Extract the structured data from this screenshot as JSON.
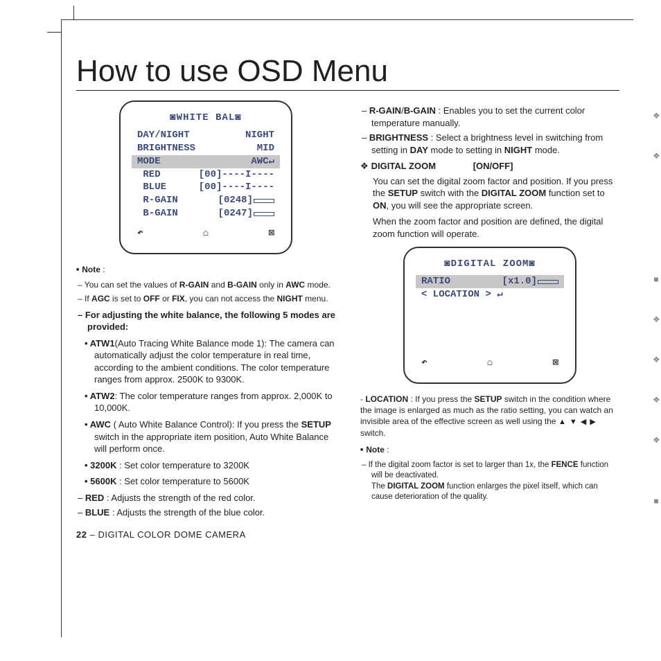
{
  "title": "How to use OSD Menu",
  "osd1": {
    "title": "◙WHITE BAL◙",
    "rows": [
      {
        "label": "DAY/NIGHT",
        "value": "NIGHT"
      },
      {
        "label": "BRIGHTNESS",
        "value": "MID"
      },
      {
        "label": "MODE",
        "value": "AWC↵",
        "selected": true
      },
      {
        "label": " RED",
        "value": "[00]----I----"
      },
      {
        "label": " BLUE",
        "value": "[00]----I----"
      },
      {
        "label": " R-GAIN",
        "value": "[0248]",
        "gauge": true
      },
      {
        "label": " B-GAIN",
        "value": "[0247]",
        "gauge": true
      }
    ],
    "foot": {
      "back": "↶",
      "home": "⌂",
      "close": "⊠"
    }
  },
  "col1": {
    "note_label": "Note",
    "note_items": [
      {
        "pre": "You can set the values of ",
        "b1": "R-GAIN",
        "mid": " and ",
        "b2": "B-GAIN",
        "post": " only in ",
        "b3": "AWC",
        "end": " mode."
      },
      {
        "pre": "If ",
        "b1": "AGC",
        "mid": " is set to ",
        "b2": "OFF",
        "mid2": " or ",
        "b3": "FIX",
        "post": ", you can not access the ",
        "b4": "NIGHT",
        "end": " menu."
      }
    ],
    "wb_heading": "For adjusting the white balance, the following 5 modes are provided:",
    "wb_modes": [
      {
        "b": "ATW1",
        "t": "(Auto Tracing White Balance mode 1): The camera can automatically adjust the color temperature in real time, according to the ambient conditions. The color temperature ranges from approx. 2500K to 9300K."
      },
      {
        "b": "ATW2",
        "t": ": The color temperature ranges from approx. 2,000K to 10,000K."
      },
      {
        "b": "AWC",
        "t": " ( Auto White Balance Control): If you press the ",
        "b2": "SETUP",
        "t2": " switch in the appropriate item position, Auto White Balance will perform once."
      },
      {
        "b": "3200K",
        "t": " : Set color temperature to 3200K"
      },
      {
        "b": "5600K",
        "t": " : Set color temperature to 5600K"
      }
    ],
    "red": {
      "b": "RED",
      "t": " : Adjusts the strength of the red color."
    },
    "blue": {
      "b": "BLUE",
      "t": " : Adjusts the strength of the blue color."
    }
  },
  "col2": {
    "rgain": {
      "b1": "R-GAIN",
      "sep": "/",
      "b2": "B-GAIN",
      "t": " : Enables you to set the current color temperature manually."
    },
    "brightness": {
      "b": "BRIGHTNESS",
      "t": " : Select a brightness level in switching from setting in ",
      "b2": "DAY",
      "t2": " mode to setting in ",
      "b3": "NIGHT",
      "t3": " mode."
    },
    "dz_heading": "DIGITAL ZOOM",
    "dz_state": "[ON/OFF]",
    "dz_para1a": "You can set the digital zoom factor and position. If you press the ",
    "dz_para1b": "SETUP",
    "dz_para1c": " switch with the ",
    "dz_para1d": "DIGITAL ZOOM",
    "dz_para1e": " function set to ",
    "dz_para1f": "ON",
    "dz_para1g": ", you will see the appropriate screen.",
    "dz_para2": "When the zoom factor and position are defined, the digital zoom function will operate.",
    "location_pre": "- ",
    "location_b": "LOCATION",
    "location_t1": " : If you press the ",
    "location_b2": "SETUP",
    "location_t2": " switch in the condition where the image is enlarged as much as the ratio setting, you can watch an invisible area of the effective screen as well using the ",
    "location_arrows": "▲ ▼ ◀ ▶",
    "location_t3": " switch.",
    "note2_label": "Note",
    "note2_items": [
      "If the digital zoom factor is set to larger than 1x, the FENCE function will be deactivated.",
      "The DIGITAL ZOOM function enlarges the pixel itself, which can cause deterioration of the quality."
    ]
  },
  "osd2": {
    "title": "◙DIGITAL ZOOM◙",
    "rows": [
      {
        "label": "RATIO",
        "value": "[x1.0]",
        "gauge": true,
        "selected": true
      },
      {
        "label": "< LOCATION > ↵",
        "value": ""
      }
    ],
    "foot": {
      "back": "↶",
      "home": "⌂",
      "close": "⊠"
    }
  },
  "footer": {
    "page": "22",
    "sep": " – ",
    "title": "DIGITAL COLOR DOME CAMERA"
  }
}
